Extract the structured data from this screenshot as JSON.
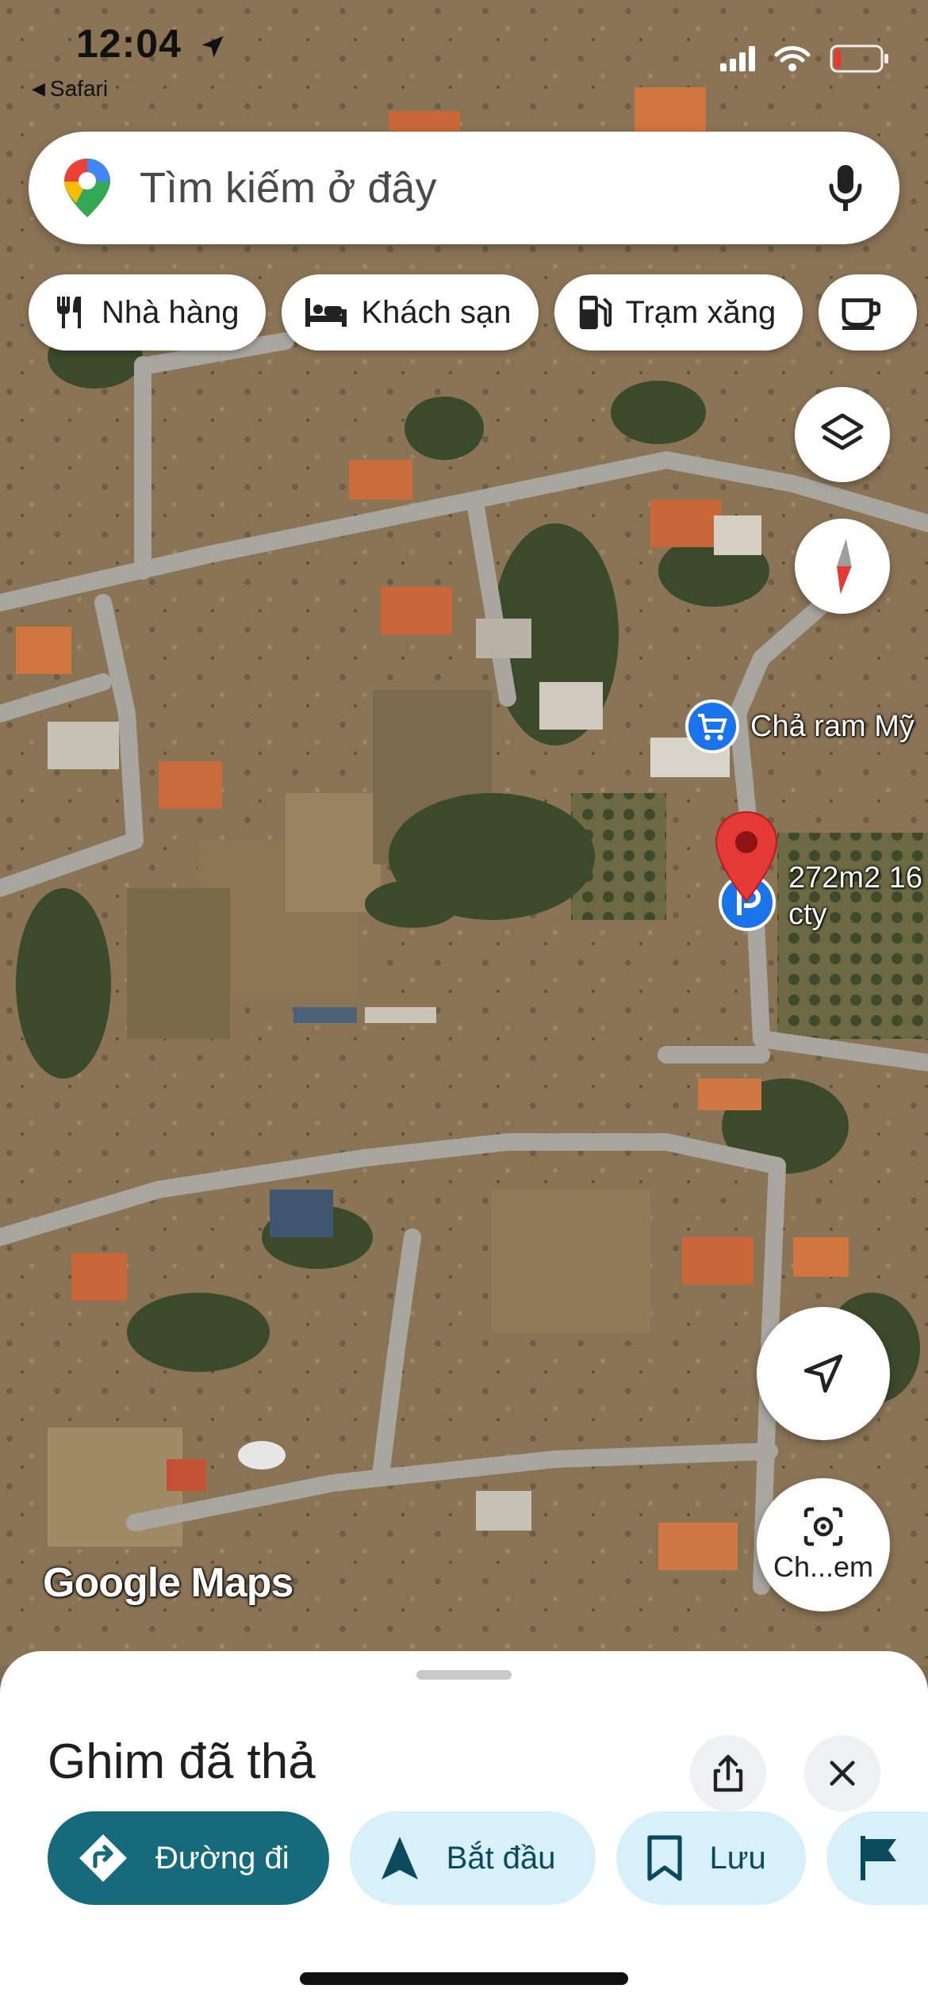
{
  "status_bar": {
    "time": "12:04",
    "back_app": "Safari"
  },
  "search": {
    "placeholder": "Tìm kiếm ở đây"
  },
  "chips": [
    {
      "label": "Nhà hàng",
      "icon": "restaurant-icon"
    },
    {
      "label": "Khách sạn",
      "icon": "hotel-icon"
    },
    {
      "label": "Trạm xăng",
      "icon": "gas-station-icon"
    },
    {
      "label": "",
      "icon": "coffee-icon"
    }
  ],
  "map": {
    "places": [
      {
        "label": "Chả ram Mỹ",
        "icon": "shopping-cart-icon"
      },
      {
        "label": "272m2 16",
        "label2": "cty",
        "icon": "parking-icon"
      }
    ],
    "watermark": "Google Maps",
    "lens_label": "Ch...em"
  },
  "sheet": {
    "title": "Ghim đã thả",
    "actions": [
      {
        "label": "Đường đi",
        "icon": "directions-icon"
      },
      {
        "label": "Bắt đầu",
        "icon": "navigation-arrow-icon"
      },
      {
        "label": "Lưu",
        "icon": "bookmark-icon"
      },
      {
        "label": "",
        "icon": "flag-icon"
      }
    ]
  },
  "colors": {
    "pin": "#e53935",
    "primary_action": "#166b7b",
    "action_bg": "#d7f0fa",
    "road": "#a9a6a0"
  }
}
